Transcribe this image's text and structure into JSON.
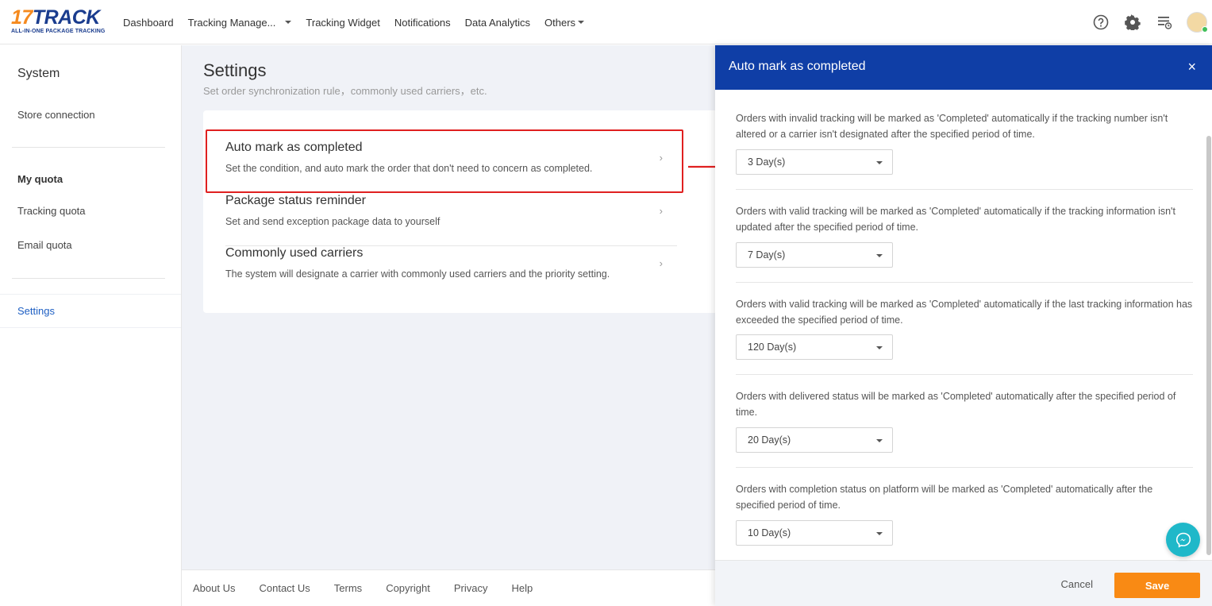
{
  "logo": {
    "brand_num": "17",
    "brand_text": "TRACK",
    "tagline": "ALL-IN-ONE PACKAGE TRACKING"
  },
  "nav": {
    "items": [
      "Dashboard",
      "Tracking Manage...",
      "Tracking Widget",
      "Notifications",
      "Data Analytics",
      "Others"
    ]
  },
  "top_icons": [
    "help-icon",
    "gear-icon",
    "task-list-icon",
    "avatar"
  ],
  "sidebar": {
    "title": "System",
    "store_connection": "Store connection",
    "my_quota": "My quota",
    "tracking_quota": "Tracking quota",
    "email_quota": "Email quota",
    "settings": "Settings"
  },
  "main": {
    "title": "Settings",
    "subtitle": "Set order synchronization rule，commonly used carriers，etc.",
    "items": [
      {
        "title": "Auto mark as completed",
        "desc": "Set the condition, and auto mark the order that don't need to concern as completed."
      },
      {
        "title": "Package status reminder",
        "desc": "Set and send exception package data to yourself"
      },
      {
        "title": "Commonly used carriers",
        "desc": "The system will designate a carrier with commonly used carriers and the priority setting."
      }
    ]
  },
  "footer": [
    "About Us",
    "Contact Us",
    "Terms",
    "Copyright",
    "Privacy",
    "Help"
  ],
  "drawer": {
    "title": "Auto mark as completed",
    "close": "×",
    "rules": [
      {
        "text": "Orders with invalid tracking will be marked as 'Completed' automatically if the tracking number isn't altered or a carrier isn't designated after the specified period of time.",
        "value": "3 Day(s)"
      },
      {
        "text": "Orders with valid tracking will be marked as 'Completed' automatically if the tracking information isn't updated after the specified period of time.",
        "value": "7 Day(s)"
      },
      {
        "text": "Orders with valid tracking will be marked as 'Completed' automatically if the last tracking information has exceeded the specified period of time.",
        "value": "120 Day(s)"
      },
      {
        "text": "Orders with delivered status will be marked as 'Completed' automatically after the specified period of time.",
        "value": "20 Day(s)"
      },
      {
        "text": "Orders with completion status on platform will be marked as 'Completed' automatically after the specified period of time.",
        "value": "10 Day(s)"
      }
    ],
    "cancel": "Cancel",
    "save": "Save"
  },
  "colors": {
    "brand_blue": "#0f3ea6",
    "save_orange": "#f98a14",
    "highlight_red": "#e02020",
    "chat_teal": "#1fb8c9"
  }
}
